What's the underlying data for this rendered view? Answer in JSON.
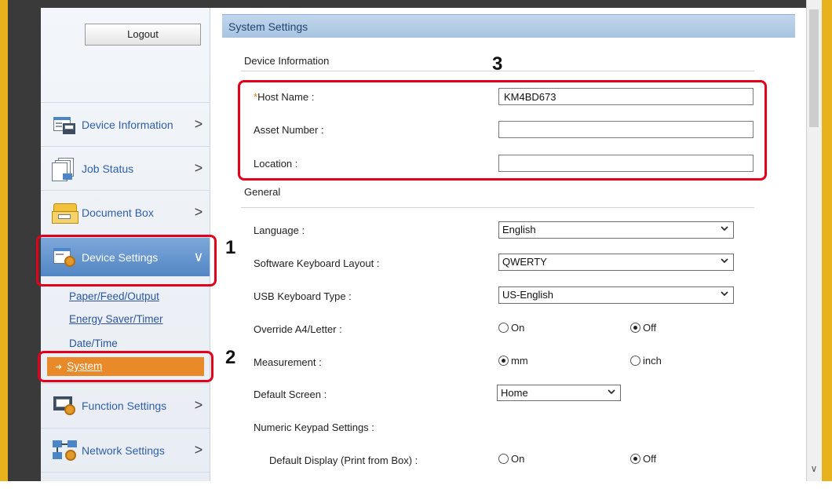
{
  "sidebar": {
    "logout_label": "Logout",
    "items": [
      {
        "label": "Device Information",
        "icon": "device-info-icon",
        "chevron": ">"
      },
      {
        "label": "Job Status",
        "icon": "job-status-icon",
        "chevron": ">"
      },
      {
        "label": "Document Box",
        "icon": "document-box-icon",
        "chevron": ">"
      },
      {
        "label": "Device Settings",
        "icon": "device-settings-icon",
        "chevron": "∨"
      },
      {
        "label": "Function Settings",
        "icon": "function-settings-icon",
        "chevron": ">"
      },
      {
        "label": "Network Settings",
        "icon": "network-settings-icon",
        "chevron": ">"
      }
    ],
    "subitems": [
      "Paper/Feed/Output",
      "Energy Saver/Timer",
      "Date/Time",
      "System"
    ]
  },
  "main": {
    "header": "System Settings",
    "device_info": {
      "title": "Device Information",
      "host_name_label": "Host Name :",
      "host_name_required": "*",
      "host_name_value": "KM4BD673",
      "asset_number_label": "Asset Number :",
      "asset_number_value": "",
      "location_label": "Location :",
      "location_value": ""
    },
    "general": {
      "title": "General",
      "language_label": "Language :",
      "language_value": "English",
      "keyboard_layout_label": "Software Keyboard Layout :",
      "keyboard_layout_value": "QWERTY",
      "usb_keyboard_label": "USB Keyboard Type :",
      "usb_keyboard_value": "US-English",
      "override_label": "Override A4/Letter :",
      "override_on": "On",
      "override_off": "Off",
      "override_selected": "Off",
      "measurement_label": "Measurement :",
      "measurement_mm": "mm",
      "measurement_inch": "inch",
      "measurement_selected": "mm",
      "default_screen_label": "Default Screen :",
      "default_screen_value": "Home",
      "numeric_keypad_label": "Numeric Keypad Settings :",
      "default_display_label": "Default Display (Print from Box) :",
      "default_display_on": "On",
      "default_display_off": "Off",
      "default_display_selected": "Off"
    }
  },
  "annotations": {
    "step1": "1",
    "step2": "2",
    "step3": "3"
  },
  "colors": {
    "callout": "#e3001b",
    "accent": "#e88a2a",
    "frame": "#e7b21c"
  }
}
